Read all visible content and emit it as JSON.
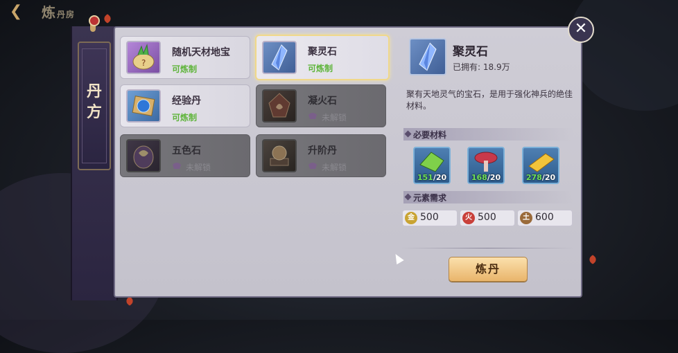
{
  "topbar": {
    "back_icon": "back-arrow-icon",
    "title": "炼",
    "title_small": "丹房"
  },
  "side_banner": {
    "label_line1": "丹",
    "label_line2": "方"
  },
  "close_icon": "close-icon",
  "recipes": [
    {
      "name": "随机天材地宝",
      "status": "可炼制",
      "state": "unlocked",
      "icon": "herb-pouch-icon"
    },
    {
      "name": "聚灵石",
      "status": "可炼制",
      "state": "selected",
      "icon": "spirit-crystal-icon"
    },
    {
      "name": "经验丹",
      "status": "可炼制",
      "state": "unlocked",
      "icon": "exp-pill-icon"
    },
    {
      "name": "凝火石",
      "status": "未解锁",
      "state": "locked",
      "icon": "fire-stone-icon"
    },
    {
      "name": "五色石",
      "status": "未解锁",
      "state": "locked",
      "icon": "five-color-stone-icon"
    },
    {
      "name": "升阶丹",
      "status": "未解锁",
      "state": "locked",
      "icon": "ascension-pill-icon"
    }
  ],
  "detail": {
    "name": "聚灵石",
    "owned_label": "已拥有: 18.9万",
    "description": "聚有天地灵气的宝石，是用于强化神兵的绝佳材料。",
    "materials_header": "必要材料",
    "materials": [
      {
        "icon": "green-crystal-icon",
        "have": "151",
        "need": "/20"
      },
      {
        "icon": "red-mushroom-icon",
        "have": "168",
        "need": "/20"
      },
      {
        "icon": "gold-bar-icon",
        "have": "278",
        "need": "/20"
      }
    ],
    "elements_header": "元素需求",
    "elements": [
      {
        "glyph": "金",
        "value": "500",
        "color": "#c9a332"
      },
      {
        "glyph": "火",
        "value": "500",
        "color": "#c9403a"
      },
      {
        "glyph": "土",
        "value": "600",
        "color": "#9a6a3a"
      }
    ],
    "craft_label": "炼丹"
  }
}
